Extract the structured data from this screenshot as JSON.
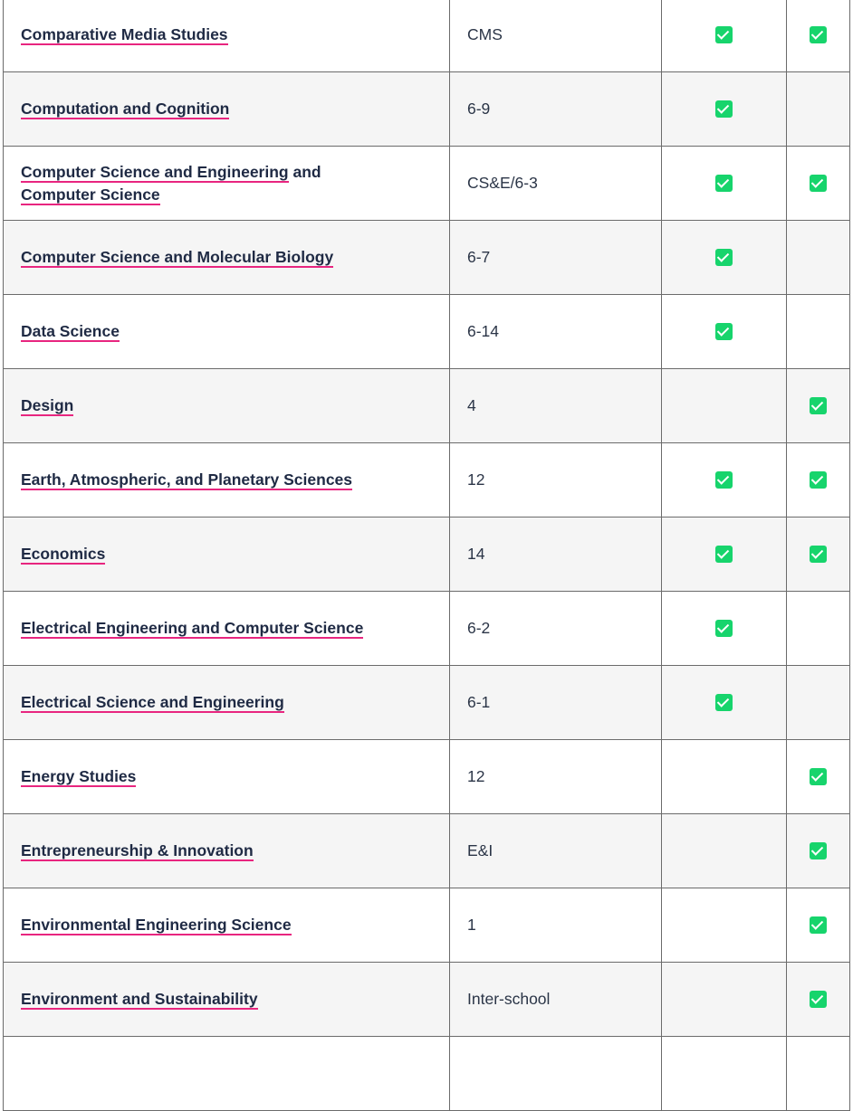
{
  "colors": {
    "check": "#17d46c",
    "link_underline": "#e8257f",
    "text": "#1f2a44"
  },
  "rows": [
    {
      "name": "Comparative Media Studies",
      "suffix": "",
      "code": "CMS",
      "col3": true,
      "col4": true
    },
    {
      "name": "Computation and Cognition",
      "suffix": "",
      "code": "6-9",
      "col3": true,
      "col4": false
    },
    {
      "name": "Computer Science and Engineering",
      "suffix": " and ",
      "name2": "Computer Science",
      "code": "CS&E/6-3",
      "col3": true,
      "col4": true
    },
    {
      "name": "Computer Science and Molecular Biology",
      "suffix": "",
      "code": "6-7",
      "col3": true,
      "col4": false
    },
    {
      "name": "Data Science",
      "suffix": "",
      "code": "6-14",
      "col3": true,
      "col4": false
    },
    {
      "name": "Design",
      "suffix": "",
      "code": "4",
      "col3": false,
      "col4": true
    },
    {
      "name": "Earth, Atmospheric, and Planetary Sciences",
      "suffix": "",
      "code": "12",
      "col3": true,
      "col4": true
    },
    {
      "name": "Economics",
      "suffix": "",
      "code": "14",
      "col3": true,
      "col4": true
    },
    {
      "name": "Electrical Engineering and Computer Science",
      "suffix": "",
      "code": "6-2",
      "col3": true,
      "col4": false
    },
    {
      "name": "Electrical Science and Engineering",
      "suffix": "",
      "code": "6-1",
      "col3": true,
      "col4": false
    },
    {
      "name": "Energy Studies",
      "suffix": "",
      "code": "12",
      "col3": false,
      "col4": true
    },
    {
      "name": "Entrepreneurship & Innovation",
      "suffix": "",
      "code": "E&I",
      "col3": false,
      "col4": true
    },
    {
      "name": "Environmental Engineering Science",
      "suffix": "",
      "code": "1",
      "col3": false,
      "col4": true
    },
    {
      "name": "Environment and Sustainability",
      "suffix": "",
      "code": "Inter-school",
      "col3": false,
      "col4": true
    }
  ]
}
